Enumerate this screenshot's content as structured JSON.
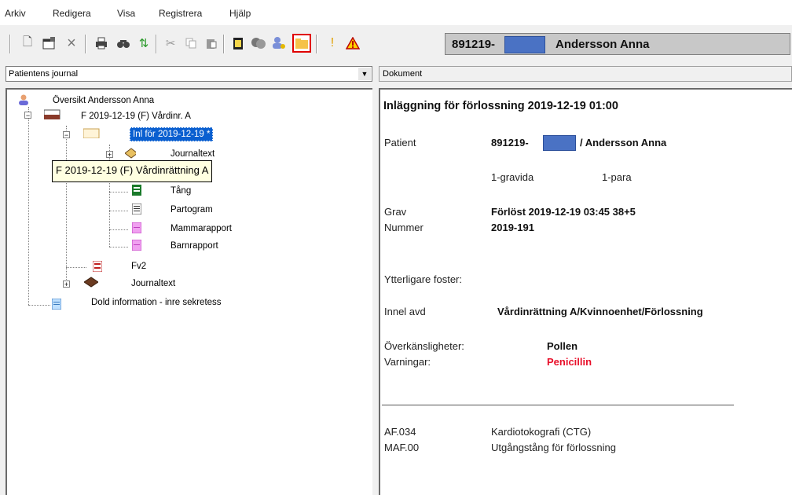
{
  "menu": [
    "Arkiv",
    "Redigera",
    "Visa",
    "Registrera",
    "Hjälp"
  ],
  "toolbar": {
    "icons": [
      "new-document-icon",
      "properties-icon",
      "delete-icon",
      "print-icon",
      "find-icon",
      "refresh-icon",
      "cut-icon",
      "copy-icon",
      "paste-icon",
      "clipboard-icon",
      "chat-icon",
      "user-key-icon",
      "folder-icon",
      "exclamation-icon",
      "warning-icon"
    ]
  },
  "patient_header": {
    "id": "891219-",
    "name": "Andersson Anna"
  },
  "left": {
    "select_value": "Patientens journal",
    "tree": {
      "overview": "Översikt Andersson Anna",
      "episode": "F 2019-12-19 (F)  Vårdinr. A",
      "admission": "Inl för 2019-12-19 *",
      "journaltext1": "Journaltext",
      "tang": "Tång",
      "partogram": "Partogram",
      "mammarapport": "Mammarapport",
      "barnrapport": "Barnrapport",
      "fv2": "Fv2",
      "journaltext2": "Journaltext",
      "hidden_info": "Dold information - inre sekretess"
    },
    "tooltip": "F 2019-12-19 (F) Vårdinrättning A"
  },
  "right": {
    "title": "Dokument",
    "heading": "Inläggning för förlossning 2019-12-19 01:00",
    "patient_label": "Patient",
    "patient_id": "891219-",
    "patient_name": "/ Andersson Anna",
    "gravida": "1-gravida",
    "para": "1-para",
    "grav_label": "Grav",
    "grav_value": "Förlöst 2019-12-19 03:45  38+5",
    "nummer_label": "Nummer",
    "nummer_value": "2019-191",
    "extra_fetus_label": "Ytterligare foster:",
    "innel_label": "Innel avd",
    "innel_value": "Vårdinrättning A/Kvinnoenhet/Förlossning",
    "allergy_label": "Överkänsligheter:",
    "allergy_value": "Pollen",
    "warning_label": "Varningar:",
    "warning_value": "Penicillin",
    "codes": [
      {
        "code": "AF.034",
        "desc": "Kardiotokografi (CTG)"
      },
      {
        "code": "MAF.00",
        "desc": "Utgångstång för förlossning"
      }
    ]
  },
  "colors": {
    "selection": "#0a5fd0",
    "warning_text": "#e8102a",
    "redaction": "#4a72c4"
  }
}
